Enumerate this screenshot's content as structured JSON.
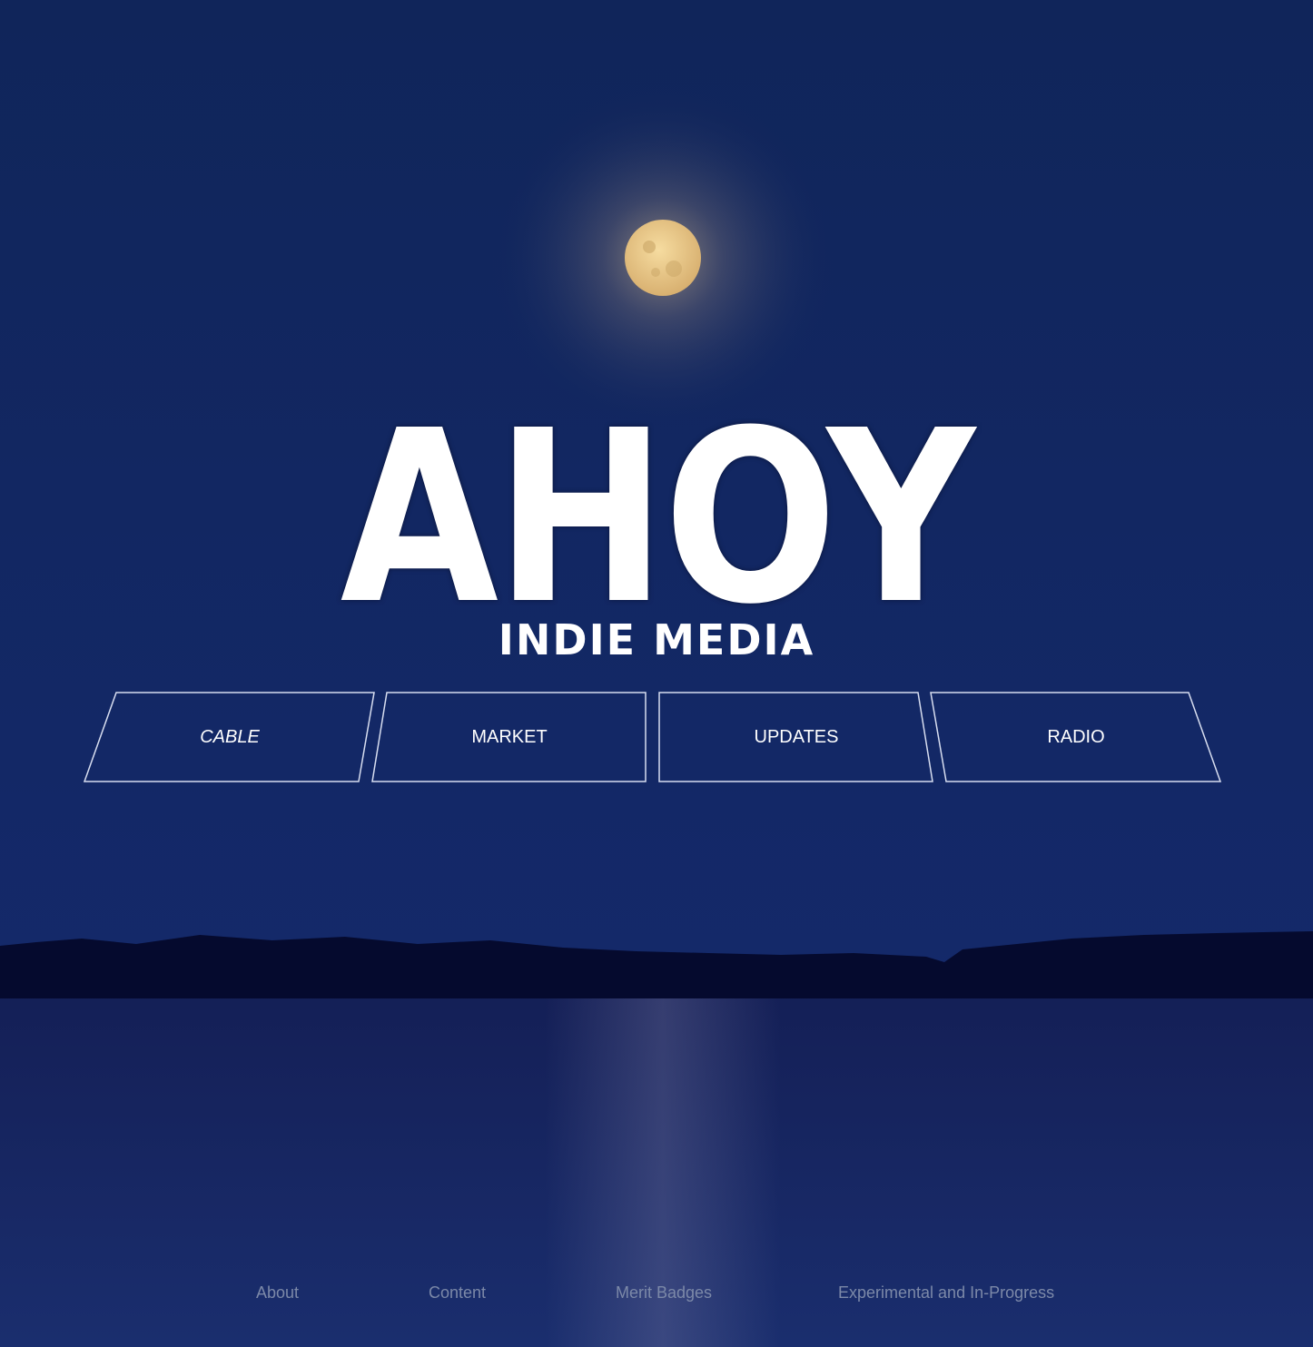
{
  "brand": {
    "title": "AHOY",
    "subtitle": "INDIE MEDIA"
  },
  "nav": {
    "cable": "CABLE",
    "market": "MARKET",
    "updates": "UPDATES",
    "radio": "RADIO"
  },
  "footer": {
    "about": "About",
    "content": "Content",
    "merit_badges": "Merit Badges",
    "experimental": "Experimental and In-Progress"
  },
  "colors": {
    "sky": "#13275a",
    "water": "#1a2d6a",
    "treeline": "#050a2a",
    "moon": "#e9c98a",
    "text": "#ffffff",
    "footer_text": "#7c89a8"
  }
}
